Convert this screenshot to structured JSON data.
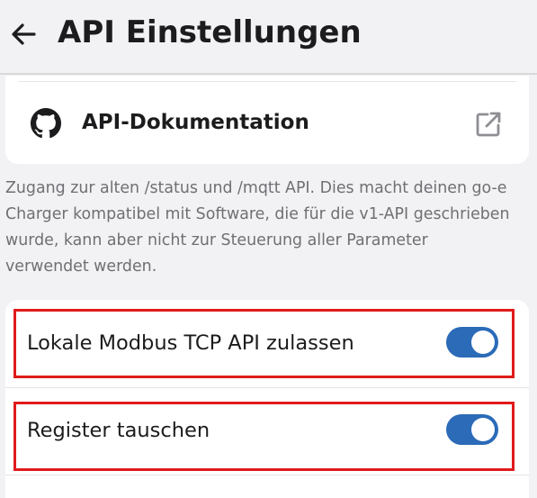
{
  "header": {
    "title": "API Einstellungen",
    "back_icon": "arrow-left-icon"
  },
  "docs_link": {
    "label": "API-Dokumentation",
    "icon": "github-icon",
    "trailing_icon": "external-link-icon"
  },
  "description": {
    "lines": [
      "Zugang zur alten /status und /mqtt API. Dies macht deinen go-e",
      "Charger kompatibel mit Software, die für die v1-API geschrieben",
      "wurde, kann aber nicht zur Steuerung aller Parameter",
      "verwendet werden."
    ]
  },
  "settings": [
    {
      "label": "Lokale Modbus TCP API zulassen",
      "enabled": true,
      "highlighted": true
    },
    {
      "label": "Register tauschen",
      "enabled": true,
      "highlighted": true
    }
  ],
  "colors": {
    "toggle_on": "#2b6bb8",
    "highlight": "#e01b1b",
    "background": "#f2f2f4",
    "secondary_text": "#6f6f74"
  }
}
